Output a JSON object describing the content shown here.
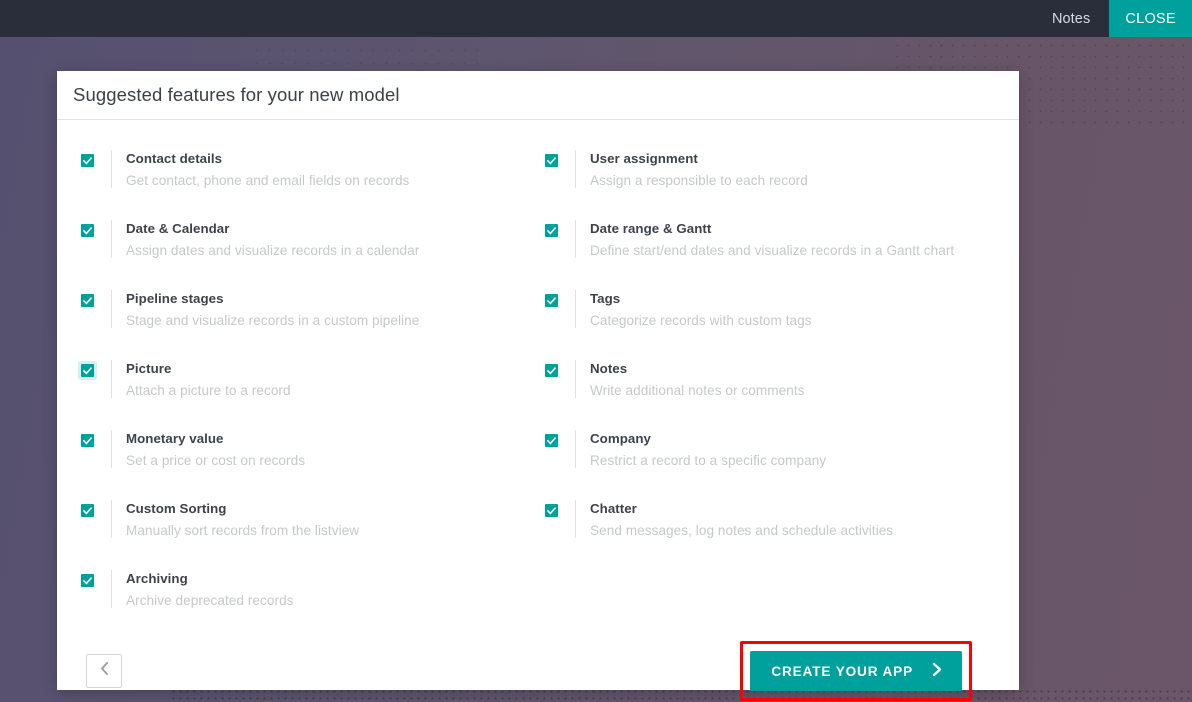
{
  "navbar": {
    "items": [
      {
        "label": "Notes",
        "name": "navbar-item-notes"
      }
    ],
    "cta_label": "CLOSE",
    "background_color": "#2a2e3b",
    "accent_color": "#00a09d"
  },
  "dialog": {
    "title": "Suggested features for your new model",
    "features": [
      {
        "label": "Contact details",
        "desc": "Get contact, phone and email fields on records",
        "checked": true,
        "column": "left"
      },
      {
        "label": "User assignment",
        "desc": "Assign a responsible to each record",
        "checked": true,
        "column": "right"
      },
      {
        "label": "Date & Calendar",
        "desc": "Assign dates and visualize records in a calendar",
        "checked": true,
        "column": "left"
      },
      {
        "label": "Date range & Gantt",
        "desc": "Define start/end dates and visualize records in a Gantt chart",
        "checked": true,
        "column": "right"
      },
      {
        "label": "Pipeline stages",
        "desc": "Stage and visualize records in a custom pipeline",
        "checked": true,
        "column": "left"
      },
      {
        "label": "Tags",
        "desc": "Categorize records with custom tags",
        "checked": true,
        "column": "right"
      },
      {
        "label": "Picture",
        "desc": "Attach a picture to a record",
        "checked": true,
        "column": "left"
      },
      {
        "label": "Notes",
        "desc": "Write additional notes or comments",
        "checked": true,
        "column": "right"
      },
      {
        "label": "Monetary value",
        "desc": "Set a price or cost on records",
        "checked": true,
        "column": "left"
      },
      {
        "label": "Company",
        "desc": "Restrict a record to a specific company",
        "checked": true,
        "column": "right"
      },
      {
        "label": "Custom Sorting",
        "desc": "Manually sort records from the listview",
        "checked": true,
        "column": "left"
      },
      {
        "label": "Chatter",
        "desc": "Send messages, log notes and schedule activities",
        "checked": true,
        "column": "right"
      },
      {
        "label": "Archiving",
        "desc": "Archive deprecated records",
        "checked": true,
        "column": "left"
      }
    ],
    "footer": {
      "back_icon": "chevron-left-icon",
      "create_label": "CREATE YOUR APP",
      "create_icon": "chevron-right-icon",
      "highlight_color": "#ff0000"
    }
  },
  "background": {
    "left_color": "#565070",
    "right_color": "#6a5668"
  }
}
